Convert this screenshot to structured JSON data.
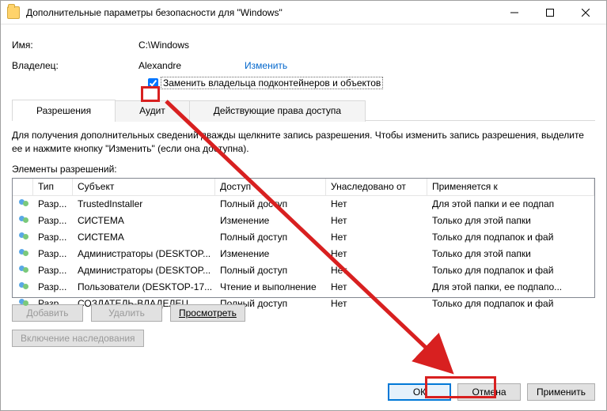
{
  "window": {
    "title": "Дополнительные параметры безопасности  для \"Windows\""
  },
  "meta": {
    "name_label": "Имя:",
    "name_value": "C:\\Windows",
    "owner_label": "Владелец:",
    "owner_value": "Alexandre",
    "change_link": "Изменить",
    "replace_owner": "Заменить владельца подконтейнеров и объектов"
  },
  "tabs": {
    "perm": "Разрешения",
    "audit": "Аудит",
    "effective": "Действующие права доступа"
  },
  "desc": "Для получения дополнительных сведений дважды щелкните запись разрешения. Чтобы изменить запись разрешения, выделите ее и нажмите кнопку \"Изменить\" (если она доступна).",
  "perm_elements_label": "Элементы разрешений:",
  "columns": {
    "type": "Тип",
    "subject": "Субъект",
    "access": "Доступ",
    "inherited": "Унаследовано от",
    "applies": "Применяется к"
  },
  "rows": [
    {
      "type": "Разр...",
      "subject": "TrustedInstaller",
      "access": "Полный доступ",
      "inh": "Нет",
      "app": "Для этой папки и ее подпап"
    },
    {
      "type": "Разр...",
      "subject": "СИСТЕМА",
      "access": "Изменение",
      "inh": "Нет",
      "app": "Только для этой папки"
    },
    {
      "type": "Разр...",
      "subject": "СИСТЕМА",
      "access": "Полный доступ",
      "inh": "Нет",
      "app": "Только для подпапок и фай"
    },
    {
      "type": "Разр...",
      "subject": "Администраторы (DESKTOP...",
      "access": "Изменение",
      "inh": "Нет",
      "app": "Только для этой папки"
    },
    {
      "type": "Разр...",
      "subject": "Администраторы (DESKTOP...",
      "access": "Полный доступ",
      "inh": "Нет",
      "app": "Только для подпапок и фай"
    },
    {
      "type": "Разр...",
      "subject": "Пользователи (DESKTOP-17...",
      "access": "Чтение и выполнение",
      "inh": "Нет",
      "app": "Для этой папки, ее подпапо..."
    },
    {
      "type": "Разр...",
      "subject": "СОЗДАТЕЛЬ-ВЛАДЕЛЕЦ",
      "access": "Полный доступ",
      "inh": "Нет",
      "app": "Только для подпапок и фай"
    }
  ],
  "buttons": {
    "add": "Добавить",
    "remove": "Удалить",
    "view": "Просмотреть",
    "inherit": "Включение наследования",
    "ok": "ОК",
    "cancel": "Отмена",
    "apply": "Применить"
  }
}
